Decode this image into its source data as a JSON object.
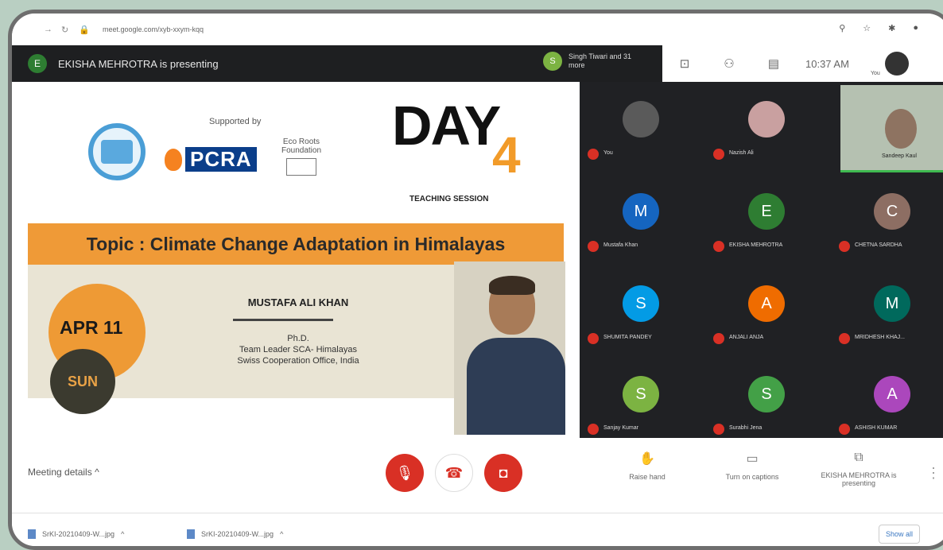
{
  "browser": {
    "url": "meet.google.com/xyb-xxym-kqq"
  },
  "presentation_bar": {
    "presenter_text": "EKISHA MEHROTRA is presenting",
    "participants_text": "Singh Tiwari and 31 more",
    "participants_initial": "S"
  },
  "toolbar": {
    "time": "10:37 AM",
    "you_label": "You"
  },
  "slide": {
    "supported_by": "Supported by",
    "pcra_logo": "PCRA",
    "eco_logo_text": "Eco Roots Foundation",
    "day_word": "DAY",
    "day_number": "4",
    "teaching": "TEACHING SESSION",
    "topic": "Topic : Climate Change Adaptation in Himalayas",
    "date": "APR 11",
    "weekday": "SUN",
    "speaker_name": "MUSTAFA ALI KHAN",
    "credential_1": "Ph.D.",
    "credential_2": "Team Leader SCA- Himalayas",
    "credential_3": "Swiss Cooperation Office, India"
  },
  "participants": [
    {
      "name": "You",
      "initial": "",
      "color": "#5a5a5a"
    },
    {
      "name": "Nazish Ali",
      "initial": "",
      "color": "#c9a0a0"
    },
    {
      "name": "Mustafa Khan",
      "initial": "M",
      "color": "#1565c0"
    },
    {
      "name": "EKISHA MEHROTRA",
      "initial": "E",
      "color": "#2e7d32"
    },
    {
      "name": "CHETNA SARDHA",
      "initial": "C",
      "color": "#8d6e63"
    },
    {
      "name": "SHUMITA PANDEY",
      "initial": "S",
      "color": "#039be5"
    },
    {
      "name": "ANJALI ANJA",
      "initial": "A",
      "color": "#ef6c00"
    },
    {
      "name": "MRIDHESH KHAJ...",
      "initial": "M",
      "color": "#00695c"
    },
    {
      "name": "Sanjay Kumar",
      "initial": "S",
      "color": "#7cb342"
    },
    {
      "name": "Surabhi Jena",
      "initial": "S",
      "color": "#43a047"
    },
    {
      "name": "ASHISH KUMAR",
      "initial": "A",
      "color": "#ab47bc"
    }
  ],
  "video_tile": {
    "name": "Sandeep Kaul"
  },
  "bottom": {
    "meeting_details": "Meeting details",
    "raise_hand": "Raise hand",
    "captions": "Turn on captions",
    "presenting": "EKISHA MEHROTRA is presenting"
  },
  "downloads": {
    "file1": "SrKI-20210409-W...jpg",
    "file2": "SrKI-20210409-W...jpg",
    "show_all": "Show all"
  }
}
